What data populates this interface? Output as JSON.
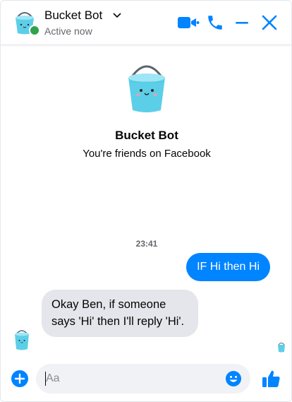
{
  "header": {
    "name": "Bucket Bot",
    "status": "Active now"
  },
  "conversation": {
    "name": "Bucket Bot",
    "subtitle": "You're friends on Facebook",
    "timestamp": "23:41"
  },
  "messages": [
    {
      "from": "me",
      "text": "IF Hi then Hi"
    },
    {
      "from": "bot",
      "text": "Okay Ben, if someone says 'Hi' then I'll reply 'Hi'."
    }
  ],
  "composer": {
    "placeholder": "Aa"
  },
  "icons": {
    "chevron": "chevron-down-icon",
    "video": "video-call-icon",
    "phone": "phone-call-icon",
    "minimize": "minimize-icon",
    "close": "close-icon",
    "plus": "plus-circle-icon",
    "emoji": "emoji-icon",
    "like": "thumbs-up-icon"
  },
  "colors": {
    "accent": "#0084ff",
    "bot_bubble": "#e4e6eb",
    "online": "#31a24c",
    "bucket": "#5ccfe8"
  }
}
